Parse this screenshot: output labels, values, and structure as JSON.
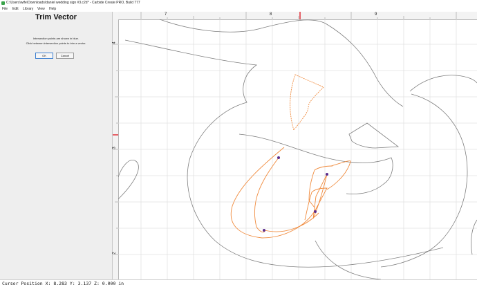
{
  "window": {
    "title": "C:\\Users\\wife\\Downloads\\daniel wedding sign #3.c2d* - Carbide Create PRO, Build 777"
  },
  "menu": {
    "items": [
      "File",
      "Edit",
      "Library",
      "View",
      "Help"
    ]
  },
  "panel": {
    "title": "Trim Vector",
    "line1": "Intersection points are shown in blue.",
    "line2": "Click between intersection points to trim a vector.",
    "ok_label": "OK",
    "cancel_label": "Cancel"
  },
  "rulers": {
    "top_labels": [
      "7",
      "8",
      "9"
    ],
    "left_labels": [
      "4",
      "3",
      "2"
    ]
  },
  "status": {
    "text": "Cursor Position X: 8.283 Y: 3.137 Z: 0.000 in"
  },
  "colors": {
    "selection": "#f08a3c",
    "intersection": "#5a2c8c",
    "vector": "#7d7d7d",
    "grid": "#e2e2e2",
    "cursor_marker": "#e0202a"
  }
}
